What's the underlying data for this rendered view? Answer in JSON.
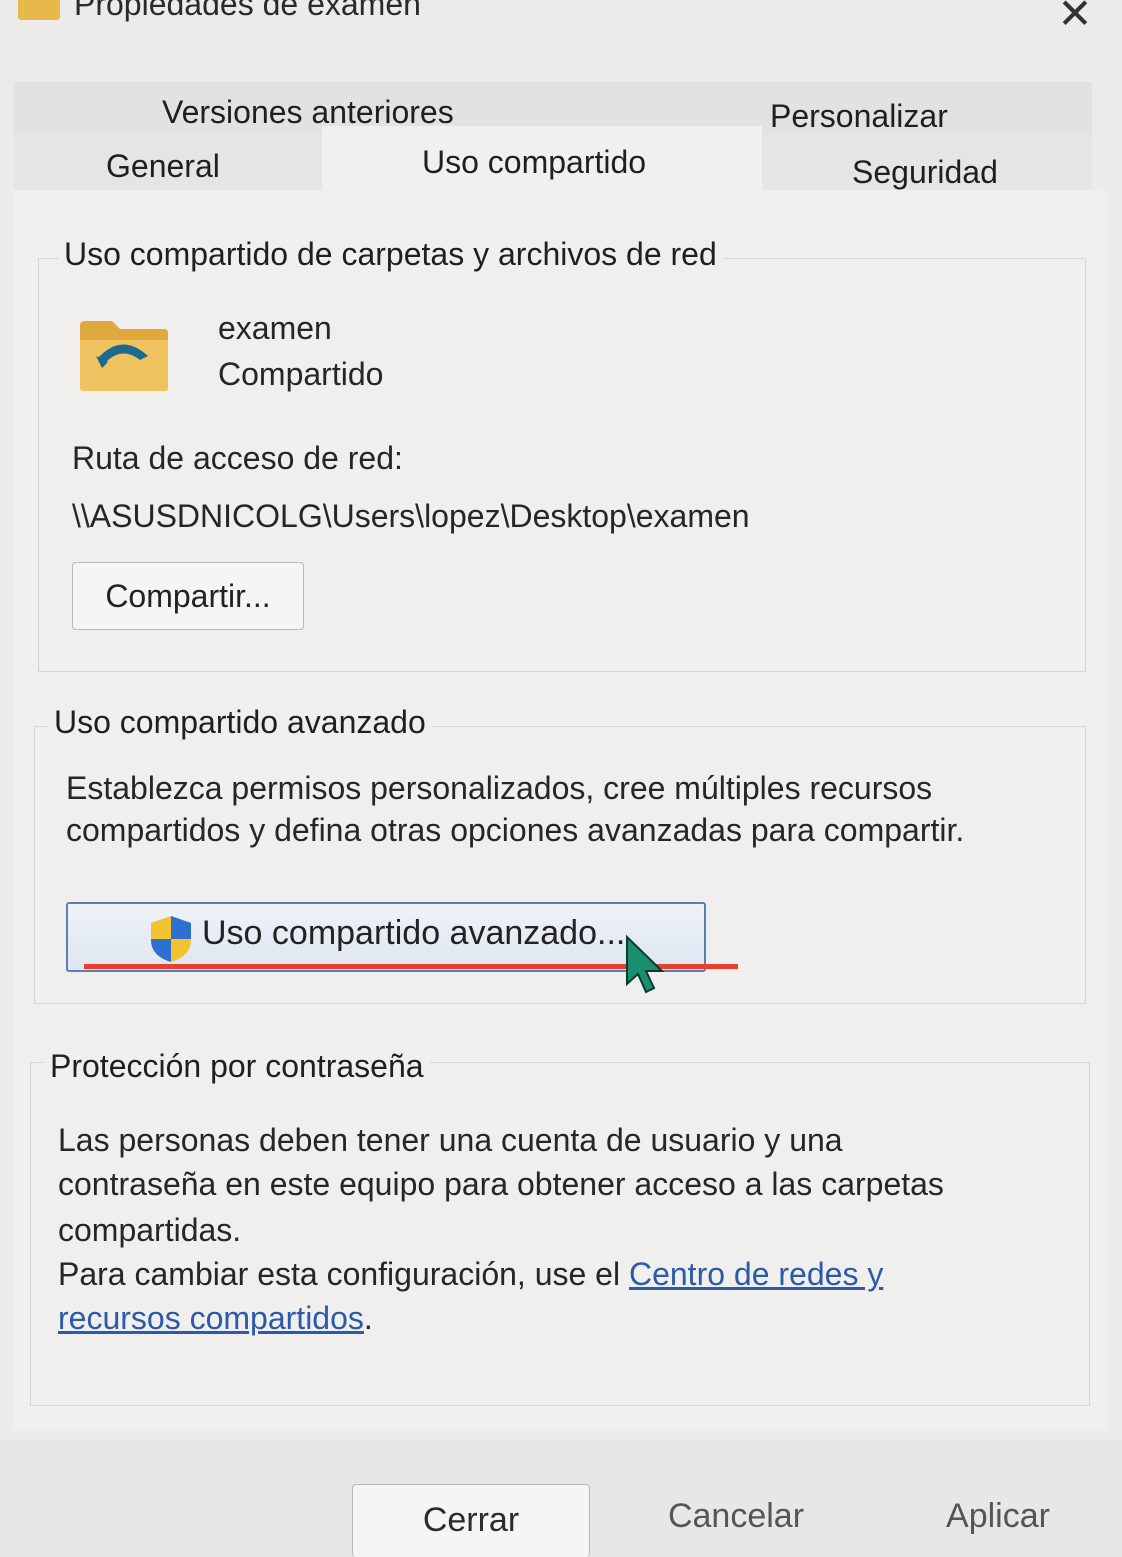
{
  "window": {
    "title": "Propiedades de examen",
    "close_symbol": "✕"
  },
  "tabs": {
    "back_row": [
      "Versiones anteriores",
      "Personalizar"
    ],
    "front_row": [
      "General",
      "Uso compartido",
      "Seguridad"
    ],
    "selected": "Uso compartido"
  },
  "network_sharing": {
    "legend": "Uso compartido de carpetas y archivos de red",
    "folder_name": "examen",
    "folder_status": "Compartido",
    "path_label": "Ruta de acceso de red:",
    "path_value": "\\\\ASUSDNICOLG\\Users\\lopez\\Desktop\\examen",
    "share_button": "Compartir..."
  },
  "advanced_sharing": {
    "legend": "Uso compartido avanzado",
    "description_line1": "Establezca permisos personalizados, cree múltiples recursos",
    "description_line2": "compartidos y defina otras opciones avanzadas para compartir.",
    "button_label": "Uso compartido avanzado..."
  },
  "password_protection": {
    "legend": "Protección por contraseña",
    "line1": "Las personas deben tener una cuenta de usuario y una",
    "line2": "contraseña en este equipo para obtener acceso a las carpetas",
    "line3": "compartidas.",
    "line4_prefix": "Para cambiar esta configuración, use el ",
    "link_part1": "Centro de redes y",
    "link_part2": "recursos compartidos",
    "line5_suffix": "."
  },
  "footer": {
    "close": "Cerrar",
    "cancel": "Cancelar",
    "apply": "Aplicar"
  },
  "colors": {
    "annotation_underline": "#e8412d",
    "link": "#2a5aa8",
    "folder": "#e7b84a"
  }
}
